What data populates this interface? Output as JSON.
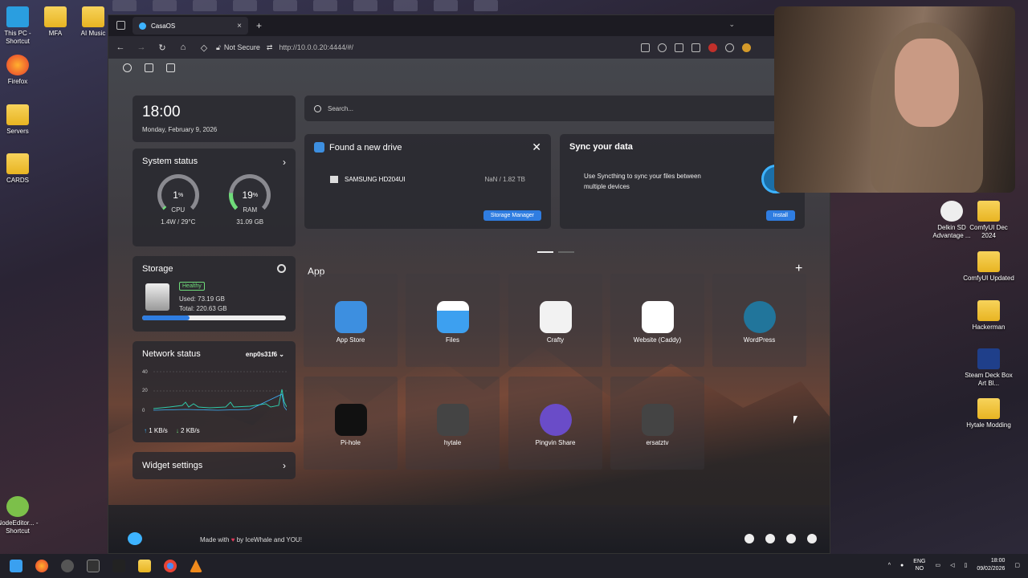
{
  "desktop": {
    "left_icons": [
      "This PC - Shortcut",
      "Firefox",
      "Servers",
      "CARDS",
      "NodeEditor... - Shortcut"
    ],
    "top_icons": [
      "MFA",
      "AI Music"
    ],
    "right_icons": [
      "Delkin SD Advantage ...",
      "ComfyUI Dec 2024",
      "ComfyUI Updated",
      "Hackerman",
      "Steam Deck Box Art Bl...",
      "Hytale Modding"
    ]
  },
  "browser": {
    "tab_title": "CasaOS",
    "security": "Not Secure",
    "url": "http://10.0.0.20:4444/#/"
  },
  "casaos": {
    "clock": {
      "time": "18:00",
      "date": "Monday, February 9, 2026"
    },
    "system_status": {
      "title": "System status",
      "cpu_value": "1",
      "cpu_label": "CPU",
      "cpu_sub": "1.4W / 29°C",
      "ram_value": "19",
      "ram_label": "RAM",
      "ram_sub": "31.09 GB",
      "pct": "%",
      "cpu_pct": 1,
      "ram_pct": 19
    },
    "storage": {
      "title": "Storage",
      "health": "Healthy",
      "used": "Used: 73.19 GB",
      "total": "Total: 220.63 GB",
      "used_fraction": 0.33
    },
    "network": {
      "title": "Network status",
      "interface": "enp0s31f6",
      "y_labels": [
        "40",
        "20",
        "0"
      ],
      "upload": "1 KB/s",
      "download": "2 KB/s"
    },
    "widget_settings": "Widget settings",
    "search_placeholder": "Search...",
    "drive_card": {
      "title": "Found a new drive",
      "drive": "SAMSUNG HD204UI",
      "size": "NaN / 1.82 TB",
      "button": "Storage Manager"
    },
    "sync_card": {
      "title": "Sync your data",
      "text": "Use Syncthing to sync your files between multiple devices",
      "button": "Install"
    },
    "app_section": "App",
    "apps": [
      "App Store",
      "Files",
      "Crafty",
      "Website (Caddy)",
      "WordPress",
      "Pi-hole",
      "hytale",
      "Pingvin Share",
      "ersatztv"
    ],
    "footer_made": "Made with",
    "footer_by": "by IceWhale and YOU!"
  },
  "taskbar": {
    "lang1": "ENG",
    "lang2": "NO",
    "time": "18:00",
    "date": "09/02/2026"
  },
  "colors": {
    "accent": "#2f7de1",
    "healthy": "#6fdc7a",
    "upload": "#3db3ff"
  }
}
